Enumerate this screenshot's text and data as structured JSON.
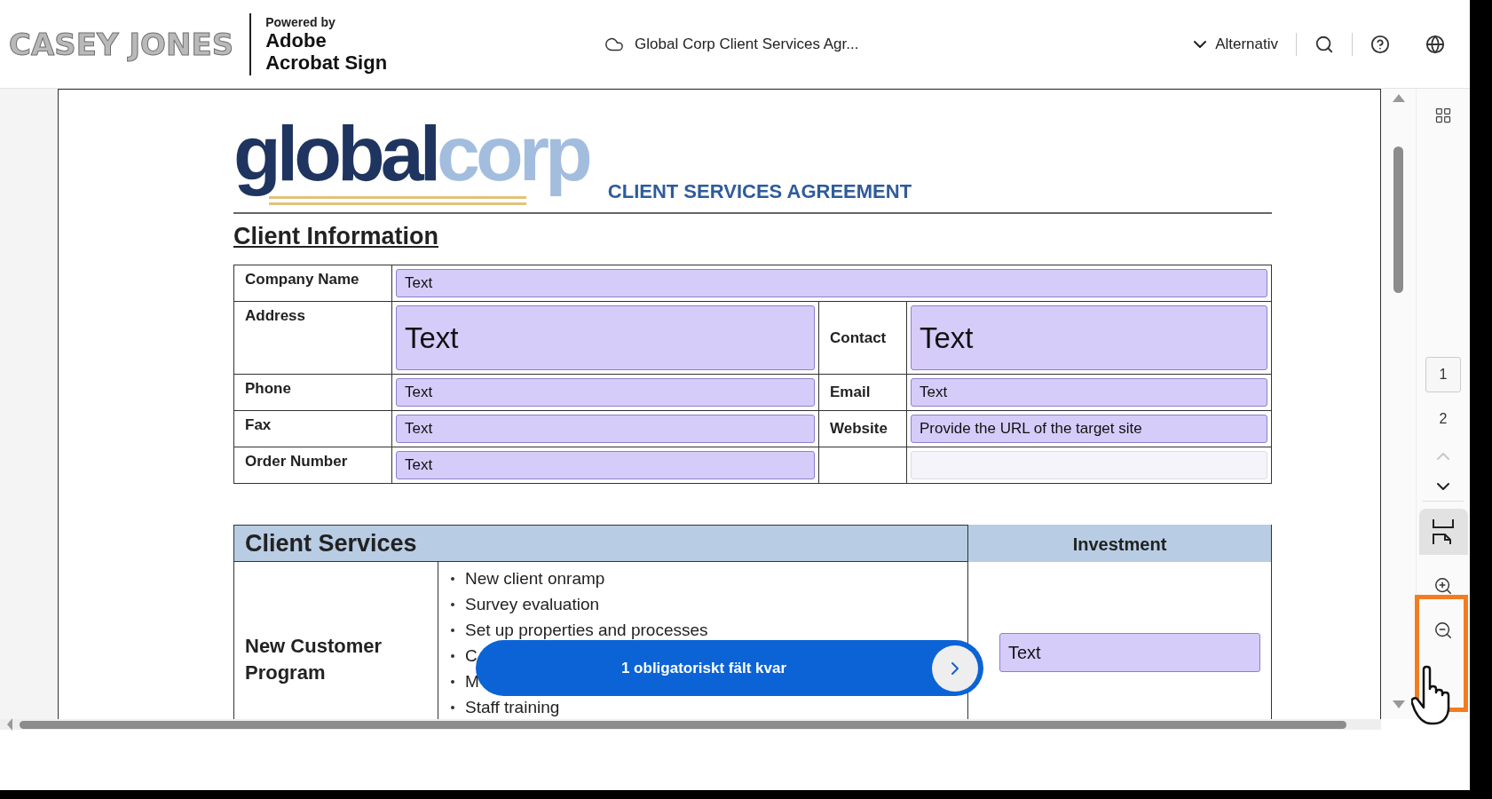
{
  "header": {
    "brand": "CASEY JONES",
    "powered_by": "Powered by",
    "product_line_1": "Adobe",
    "product_line_2": "Acrobat Sign",
    "document_title": "Global Corp Client Services Agr...",
    "options_label": "Alternativ"
  },
  "document": {
    "logo_dark": "global",
    "logo_light": "corp",
    "title": "CLIENT SERVICES AGREEMENT",
    "section_heading": "Client Information",
    "client_rows": [
      {
        "kind": "span",
        "label": "Company Name",
        "value": "Text",
        "large": false
      },
      {
        "kind": "pair",
        "label": "Address",
        "value": "Text",
        "large": true,
        "label_2": "Contact",
        "value_2": "Text"
      },
      {
        "kind": "pair",
        "label": "Phone",
        "value": "Text",
        "large": false,
        "label_2": "Email",
        "value_2": "Text"
      },
      {
        "kind": "pair",
        "label": "Fax",
        "value": "Text",
        "large": false,
        "label_2": "Website",
        "value_2": "Provide the URL  of the target site"
      },
      {
        "kind": "single",
        "label": "Order Number",
        "value": "Text",
        "large": false
      }
    ],
    "services": {
      "heading": "Client Services",
      "investment_heading": "Investment",
      "program": "New Customer Program",
      "items": [
        "New client onramp",
        "Survey evaluation",
        "Set up properties and processes",
        "C",
        "M",
        "Staff training"
      ],
      "investment_value": "Text"
    }
  },
  "banner": {
    "text": "1 obligatoriskt fält kvar"
  },
  "rail": {
    "pages": [
      {
        "label": "1",
        "selected": true
      },
      {
        "label": "2",
        "selected": false
      }
    ],
    "nav": [
      {
        "kind": "up",
        "disabled": true
      },
      {
        "kind": "down",
        "disabled": false
      }
    ]
  }
}
